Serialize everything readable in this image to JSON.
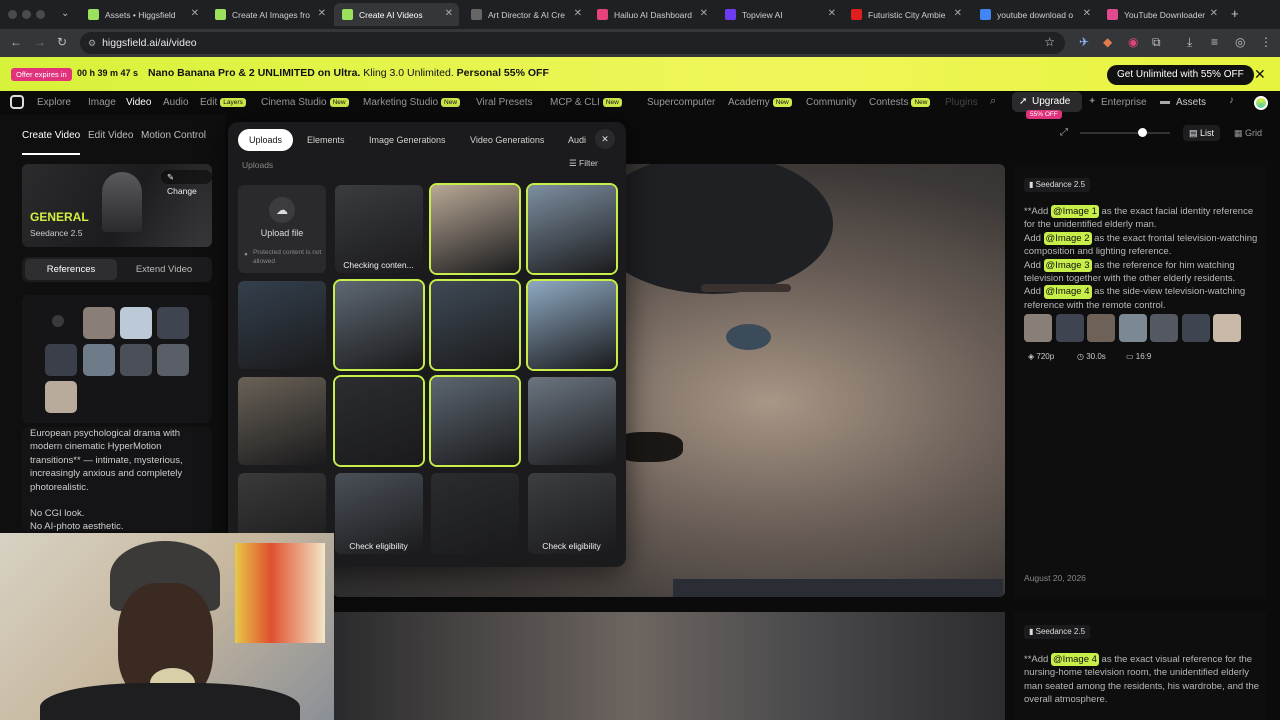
{
  "browser": {
    "tabs": [
      {
        "title": "Assets • Higgsfield",
        "fav": "#9be15d"
      },
      {
        "title": "Create AI Images fro",
        "fav": "#9be15d"
      },
      {
        "title": "Create AI Videos",
        "fav": "#9be15d",
        "active": true
      },
      {
        "title": "Art Director & AI Cre",
        "fav": "#666"
      },
      {
        "title": "Hailuo AI Dashboard",
        "fav": "#e8427a"
      },
      {
        "title": "Topview AI",
        "fav": "#6d3cf0"
      },
      {
        "title": "Futuristic City Ambie",
        "fav": "#e01e1e"
      },
      {
        "title": "youtube download o",
        "fav": "#4285f4"
      },
      {
        "title": "YouTube Downloader",
        "fav": "#e14a8c"
      }
    ],
    "url": "higgsfield.ai/ai/video"
  },
  "promo": {
    "offer_label": "Offer expires in",
    "timer": "00 h 39 m 47 s",
    "text_bold": "Nano Banana Pro & 2 UNLIMITED on Ultra.",
    "text_mid": " Kling 3.0 Unlimited. ",
    "text_bold2": "Personal 55% OFF",
    "cta": "Get Unlimited with 55% OFF"
  },
  "nav": {
    "items": [
      "Explore",
      "Image",
      "Video",
      "Audio",
      "Edit",
      "Cinema Studio",
      "Marketing Studio",
      "Viral Presets",
      "MCP & CLI",
      "Supercomputer",
      "Academy",
      "Community",
      "Contests",
      "Plugins"
    ],
    "badge_layers": "Layers",
    "badge_new": "New",
    "upgrade": "Upgrade",
    "upgrade_badge": "55% OFF",
    "enterprise": "Enterprise",
    "assets": "Assets"
  },
  "left": {
    "tabs": [
      "Create Video",
      "Edit Video",
      "Motion Control"
    ],
    "model_title": "GENERAL",
    "model_name": "Seedance 2.5",
    "change": "Change",
    "ref_tab": "References",
    "extend_tab": "Extend Video",
    "prompt": "European psychological drama with modern cinematic HyperMotion transitions** — intimate, mysterious, increasingly anxious and completely photorealistic.",
    "prompt2": "No CGI look.",
    "prompt3": "No AI-photo aesthetic."
  },
  "uploads": {
    "tabs": [
      "Uploads",
      "Elements",
      "Image Generations",
      "Video Generations",
      "Audi"
    ],
    "section": "Uploads",
    "filter": "Filter",
    "upload_file": "Upload file",
    "protected": "Protected content is not allowed",
    "checking": "Checking conten...",
    "check1": "Check eligibility",
    "check2": "Check eligibility"
  },
  "view": {
    "list": "List",
    "grid": "Grid"
  },
  "result1": {
    "model": "Seedance 2.5",
    "p1a": "**Add ",
    "tag1": "@Image 1",
    "p1b": " as the exact facial identity reference for the unidentified elderly man.",
    "p2a": "Add ",
    "tag2": "@Image 2",
    "p2b": " as the exact frontal television-watching composition and lighting reference.",
    "p3a": "Add ",
    "tag3": "@Image 3",
    "p3b": " as the reference for him watching television together with the other elderly residents.",
    "p4a": "Add ",
    "tag4": "@Image 4",
    "p4b": " as the side-view television-watching reference with the remote control.",
    "res": "720p",
    "dur": "30.0s",
    "ratio": "16:9",
    "date": "August 20, 2026"
  },
  "result2": {
    "model": "Seedance 2.5",
    "pa": "**Add ",
    "tag": "@Image 4",
    "pb": " as the exact visual reference for the nursing-home television room, the unidentified elderly man seated among the residents, his wardrobe, and the overall atmosphere."
  }
}
